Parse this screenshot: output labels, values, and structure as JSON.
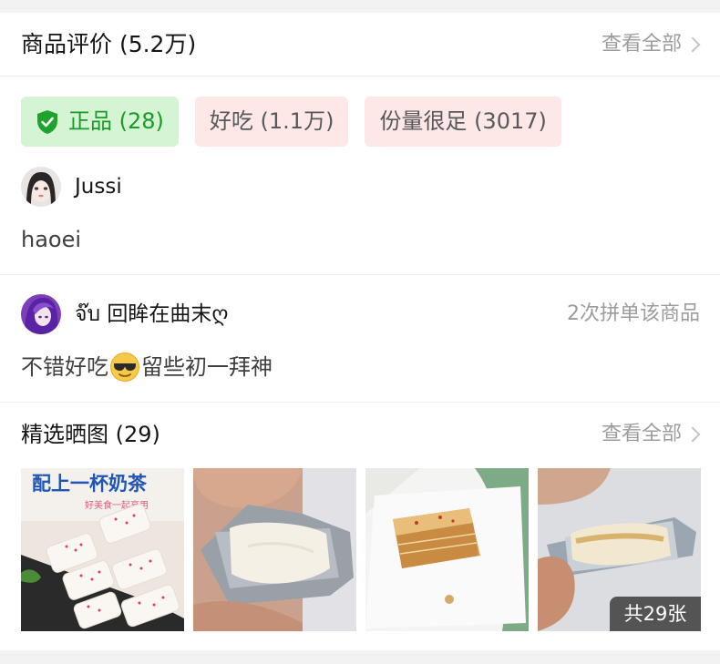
{
  "header": {
    "title": "商品评价 (5.2万)",
    "more": "查看全部"
  },
  "tags": [
    {
      "label": "正品 (28)",
      "icon": "shield-check-icon",
      "color": "#1b9a28"
    },
    {
      "label": "好吃 (1.1万)"
    },
    {
      "label": "份量很足 (3017)"
    }
  ],
  "reviews": [
    {
      "user": "Jussi",
      "text": "haoei",
      "meta": ""
    },
    {
      "user": "จ๊บ 回眸在曲末ღ",
      "meta": "2次拼单该商品",
      "text": "不错好吃",
      "emoji": "sunglasses-face-icon",
      "text_after": "留些初一拜神"
    }
  ],
  "photos": {
    "title": "精选晒图 (29)",
    "more": "查看全部",
    "count_label": "共29张"
  },
  "poster_text": {
    "headline": "配上一杯奶茶",
    "sub": "好美食一起享用"
  }
}
